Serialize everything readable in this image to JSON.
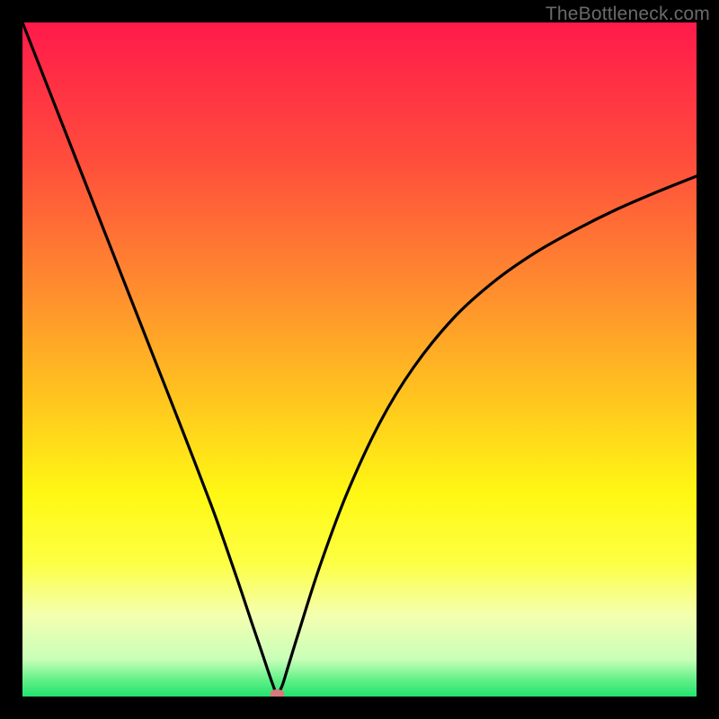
{
  "watermark": "TheBottleneck.com",
  "chart_data": {
    "type": "line",
    "title": "",
    "xlabel": "",
    "ylabel": "",
    "xlim": [
      0,
      100
    ],
    "ylim": [
      0,
      100
    ],
    "grid": false,
    "legend": false,
    "gradient_stops": [
      {
        "offset": 0.0,
        "color": "#ff1a4b"
      },
      {
        "offset": 0.2,
        "color": "#ff4c3c"
      },
      {
        "offset": 0.4,
        "color": "#ff8e2e"
      },
      {
        "offset": 0.55,
        "color": "#ffc21f"
      },
      {
        "offset": 0.7,
        "color": "#fff814"
      },
      {
        "offset": 0.8,
        "color": "#fdff42"
      },
      {
        "offset": 0.88,
        "color": "#f4ffb0"
      },
      {
        "offset": 0.945,
        "color": "#c8ffb8"
      },
      {
        "offset": 0.975,
        "color": "#63f089"
      },
      {
        "offset": 1.0,
        "color": "#22e36d"
      }
    ],
    "series": [
      {
        "name": "curve",
        "x": [
          0,
          4,
          8,
          12,
          16,
          20,
          24,
          28,
          30,
          32,
          34,
          35.5,
          36.5,
          37.2,
          37.6,
          38.0,
          38.6,
          39.4,
          41.0,
          44.0,
          48.0,
          53.0,
          58.0,
          64.0,
          70.0,
          76.0,
          82.0,
          88.0,
          94.0,
          100.0
        ],
        "y": [
          100.0,
          89.8,
          79.6,
          69.4,
          59.2,
          49.0,
          38.8,
          28.4,
          22.8,
          17.0,
          11.0,
          6.6,
          3.6,
          1.6,
          0.6,
          0.6,
          1.8,
          4.4,
          9.6,
          19.0,
          29.8,
          40.6,
          48.8,
          56.2,
          61.6,
          65.8,
          69.2,
          72.2,
          74.8,
          77.2
        ]
      }
    ],
    "marker": {
      "x": 37.8,
      "y": 0.4,
      "color": "#d9797e",
      "rx": 8,
      "ry": 5
    }
  }
}
